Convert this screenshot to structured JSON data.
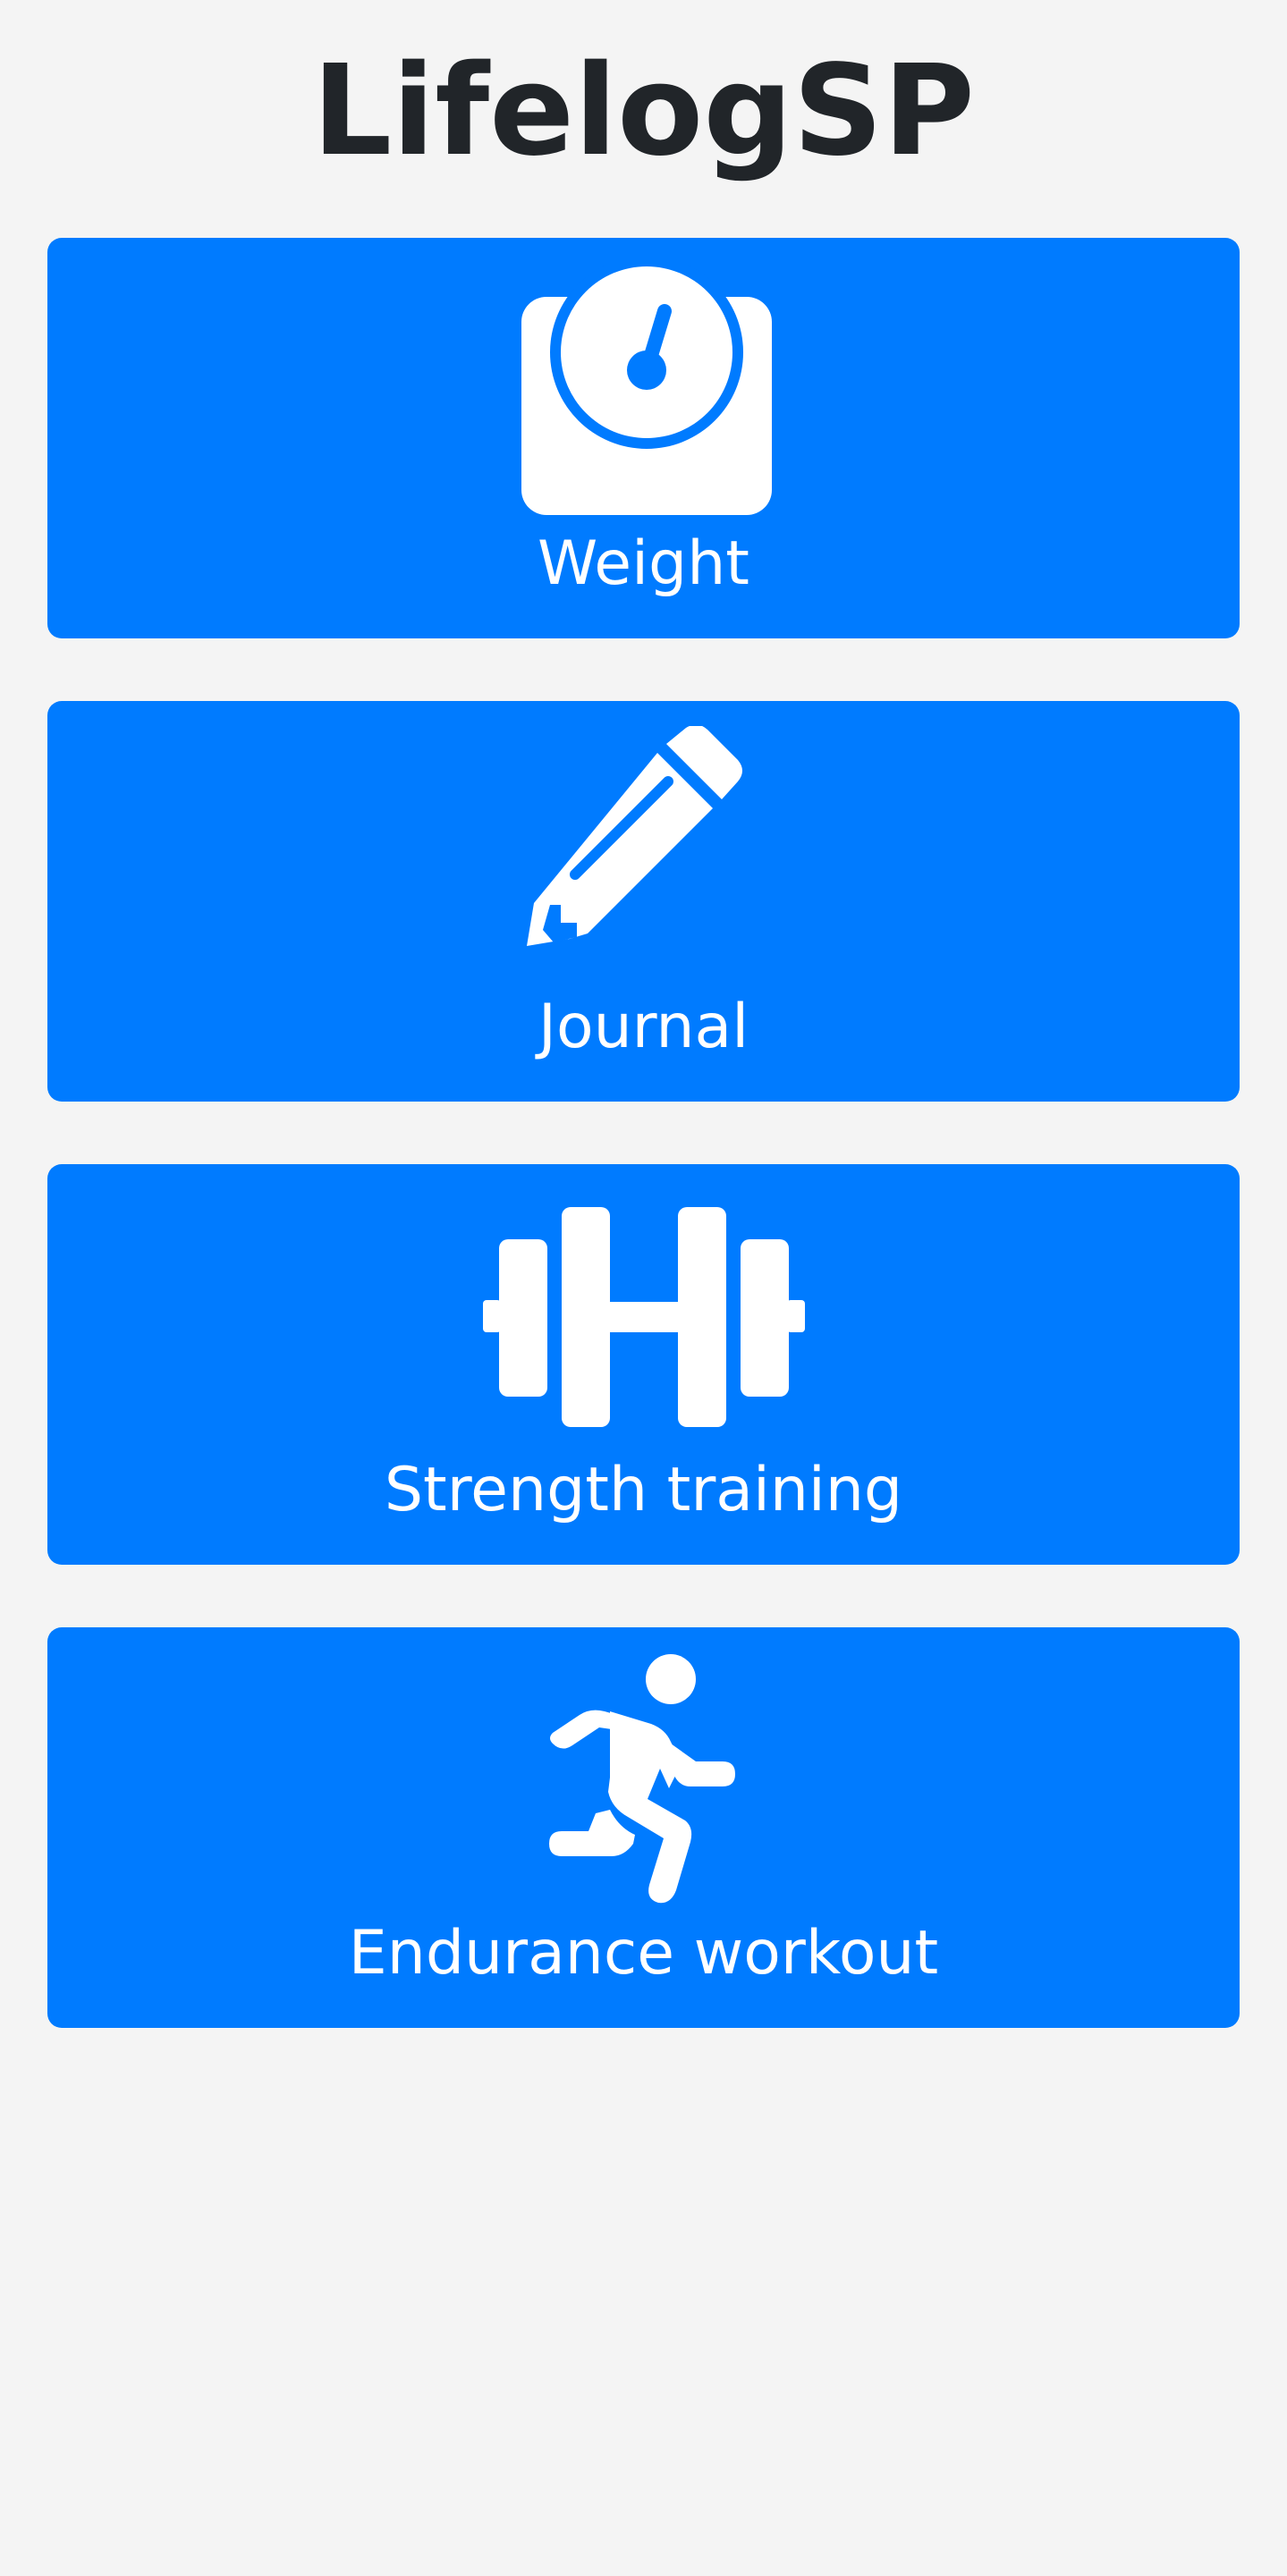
{
  "app": {
    "title": "LifelogSP"
  },
  "tiles": [
    {
      "label": "Weight",
      "icon": "scale-icon"
    },
    {
      "label": "Journal",
      "icon": "pencil-icon"
    },
    {
      "label": "Strength training",
      "icon": "dumbbell-icon"
    },
    {
      "label": "Endurance workout",
      "icon": "running-person-icon"
    }
  ],
  "colors": {
    "tile_background": "#007bff",
    "page_background": "#f4f4f4",
    "title_text": "#212529",
    "tile_text": "#ffffff"
  }
}
